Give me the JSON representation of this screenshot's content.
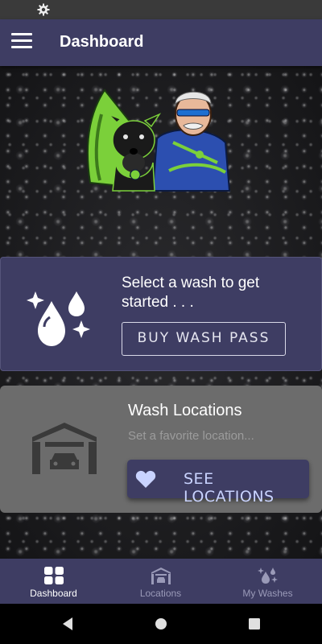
{
  "app_bar": {
    "title": "Dashboard"
  },
  "wash_card": {
    "prompt": "Select a wash to get started . . .",
    "button_label": "BUY WASH PASS"
  },
  "locations_card": {
    "title": "Wash Locations",
    "subtitle": "Set a favorite location...",
    "button_label": "SEE LOCATIONS"
  },
  "bottom_nav": [
    {
      "label": "Dashboard",
      "icon": "dashboard-grid-icon",
      "active": true
    },
    {
      "label": "Locations",
      "icon": "garage-icon",
      "active": false
    },
    {
      "label": "My Washes",
      "icon": "drops-sparkle-icon",
      "active": false
    }
  ],
  "colors": {
    "primary": "#3e3d63",
    "card_gray": "#6c6c6c",
    "accent_text": "#c9d3ff",
    "mascot_green": "#7bd03a"
  }
}
